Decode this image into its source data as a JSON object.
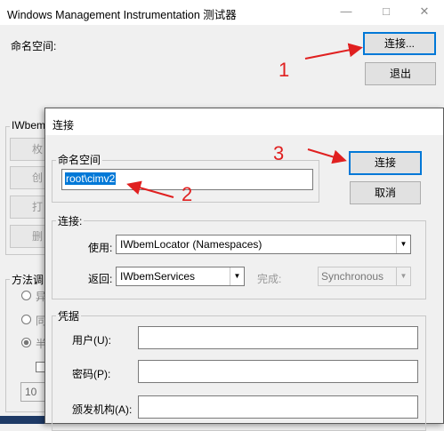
{
  "main_window": {
    "title": "Windows Management Instrumentation 测试器",
    "namespace_label": "命名空间:",
    "connect_label": "连接...",
    "exit_label": "退出",
    "group_iwbem": "IWbem",
    "left_buttons": [
      "枚",
      "创",
      "打",
      "删"
    ],
    "method_group": "方法调",
    "radio_labels": [
      "异",
      "同",
      "半"
    ],
    "count_value": "10"
  },
  "dialog": {
    "title": "连接",
    "namespace_group": "命名空间",
    "namespace_value": "root\\cimv2",
    "connect_button": "连接",
    "cancel_button": "取消",
    "connection_group": "连接:",
    "use_label": "使用:",
    "use_value": "IWbemLocator (Namespaces)",
    "return_label": "返回:",
    "return_value": "IWbemServices",
    "complete_label": "完成:",
    "complete_value": "Synchronous",
    "credentials_group": "凭据",
    "user_label": "用户(U):",
    "password_label": "密码(P):",
    "authority_label": "颁发机构(A):"
  },
  "annotations": {
    "n1": "1",
    "n2": "2",
    "n3": "3"
  },
  "colors": {
    "annotation": "#e02020",
    "selection": "#0078d7"
  }
}
